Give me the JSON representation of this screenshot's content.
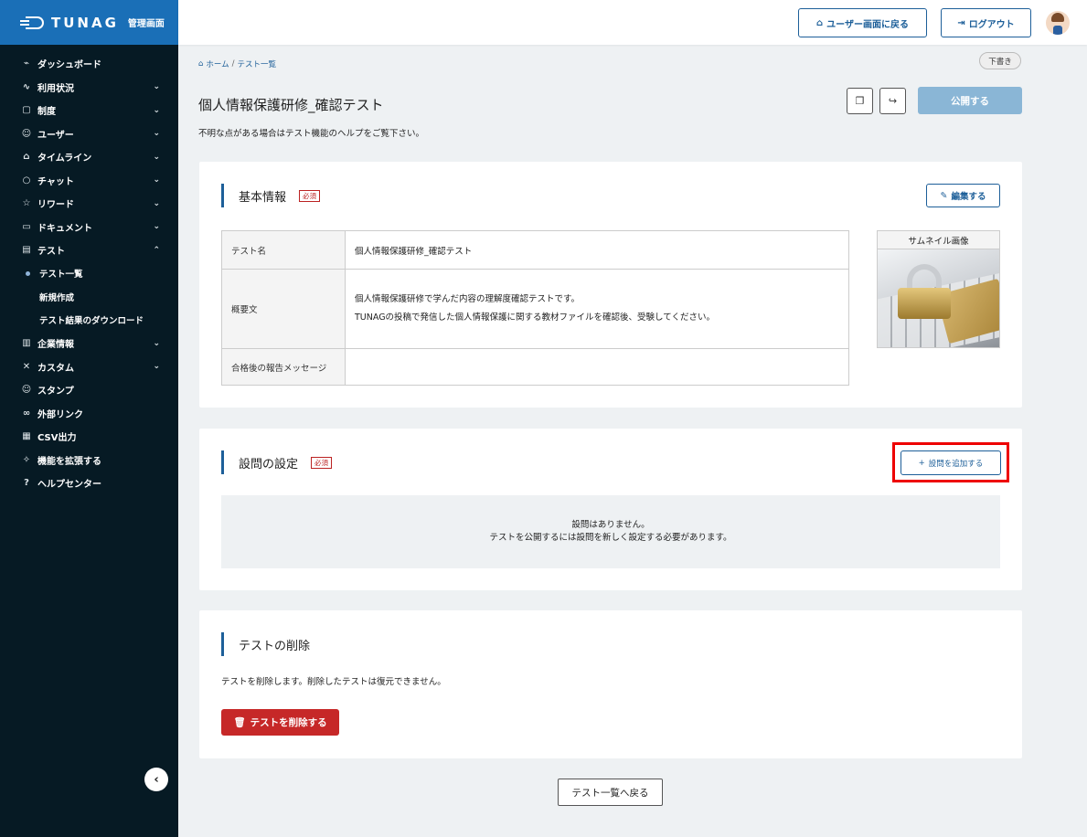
{
  "brand": {
    "logo_text": "TUNAG",
    "admin_label": "管理画面"
  },
  "sidebar": {
    "items": [
      {
        "icon": "chart-line-icon",
        "glyph": "⌁",
        "label": "ダッシュボード",
        "chevron": ""
      },
      {
        "icon": "activity-icon",
        "glyph": "∿",
        "label": "利用状況",
        "chevron": "⌄"
      },
      {
        "icon": "book-icon",
        "glyph": "▢",
        "label": "制度",
        "chevron": "⌄"
      },
      {
        "icon": "users-icon",
        "glyph": "☺",
        "label": "ユーザー",
        "chevron": "⌄"
      },
      {
        "icon": "home-icon",
        "glyph": "⌂",
        "label": "タイムライン",
        "chevron": "⌄"
      },
      {
        "icon": "chat-icon",
        "glyph": "○",
        "label": "チャット",
        "chevron": "⌄"
      },
      {
        "icon": "star-icon",
        "glyph": "☆",
        "label": "リワード",
        "chevron": "⌄"
      },
      {
        "icon": "folder-icon",
        "glyph": "▭",
        "label": "ドキュメント",
        "chevron": "⌄"
      },
      {
        "icon": "test-icon",
        "glyph": "▤",
        "label": "テスト",
        "chevron": "⌃"
      }
    ],
    "sub_items": [
      {
        "label": "テスト一覧",
        "active": true
      },
      {
        "label": "新規作成",
        "active": false
      },
      {
        "label": "テスト結果のダウンロード",
        "active": false
      }
    ],
    "items_after": [
      {
        "icon": "building-icon",
        "glyph": "▥",
        "label": "企業情報",
        "chevron": "⌄"
      },
      {
        "icon": "tools-icon",
        "glyph": "✕",
        "label": "カスタム",
        "chevron": "⌄"
      },
      {
        "icon": "smile-icon",
        "glyph": "☺",
        "label": "スタンプ",
        "chevron": ""
      },
      {
        "icon": "link-icon",
        "glyph": "∞",
        "label": "外部リンク",
        "chevron": ""
      },
      {
        "icon": "csv-icon",
        "glyph": "▦",
        "label": "CSV出力",
        "chevron": ""
      },
      {
        "icon": "extension-icon",
        "glyph": "✧",
        "label": "機能を拡張する",
        "chevron": ""
      },
      {
        "icon": "help-icon",
        "glyph": "?",
        "label": "ヘルプセンター",
        "chevron": ""
      }
    ],
    "collapse_glyph": "‹"
  },
  "header": {
    "user_screen_label": "ユーザー画面に戻る",
    "logout_label": "ログアウト"
  },
  "breadcrumb": {
    "home": "ホーム",
    "sep": "/",
    "current": "テスト一覧"
  },
  "status_badge": "下書き",
  "page": {
    "title": "個人情報保護研修_確認テスト",
    "help": "不明な点がある場合はテスト機能のヘルプをご覧下さい。",
    "publish_label": "公開する"
  },
  "basic": {
    "title": "基本情報",
    "required": "必須",
    "edit_label": "編集する",
    "rows": {
      "name_label": "テスト名",
      "name_value": "個人情報保護研修_確認テスト",
      "desc_label": "概要文",
      "desc_line1": "個人情報保護研修で学んだ内容の理解度確認テストです。",
      "desc_line2": "TUNAGの投稿で発信した個人情報保護に関する教材ファイルを確認後、受験してください。",
      "msg_label": "合格後の報告メッセージ",
      "msg_value": ""
    },
    "thumbnail_label": "サムネイル画像"
  },
  "questions": {
    "title": "設問の設定",
    "required": "必須",
    "add_label": "設問を追加する",
    "empty_line1": "設問はありません。",
    "empty_line2": "テストを公開するには設問を新しく設定する必要があります。"
  },
  "delete": {
    "title": "テストの削除",
    "desc": "テストを削除します。削除したテストは復元できません。",
    "button_label": "テストを削除する"
  },
  "back_label": "テスト一覧へ戻る",
  "colors": {
    "brand": "#1a6fb7",
    "sidebar_bg": "#061a24",
    "accent": "#1d5f99",
    "danger": "#c62828",
    "highlight": "#ee0000"
  }
}
